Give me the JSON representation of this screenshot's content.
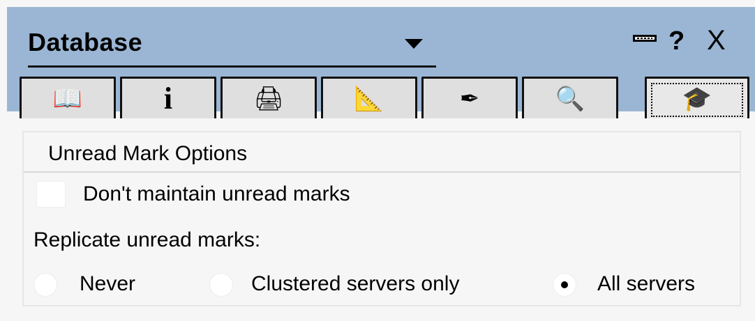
{
  "panel": {
    "title": "Database",
    "controls": {
      "minimize_icon": "minimize-icon",
      "help_label": "?",
      "close_label": "X"
    }
  },
  "tabs": [
    {
      "icon": "book-icon",
      "glyph": "📖",
      "active": false
    },
    {
      "icon": "info-icon",
      "glyph": "i",
      "active": false
    },
    {
      "icon": "printer-icon",
      "glyph": "🖨",
      "active": false
    },
    {
      "icon": "ruler-triangle-icon",
      "glyph": "📐",
      "active": false
    },
    {
      "icon": "pen-icon",
      "glyph": "✒",
      "active": false
    },
    {
      "icon": "magnifier-icon",
      "glyph": "🔍",
      "active": false
    },
    {
      "icon": "cap-icon",
      "glyph": "🎓",
      "active": true
    }
  ],
  "section": {
    "title": "Unread Mark Options",
    "checkbox": {
      "label": "Don't maintain unread marks",
      "checked": false
    },
    "radio_group": {
      "label": "Replicate unread marks:",
      "options": [
        {
          "label": "Never",
          "checked": false
        },
        {
          "label": "Clustered servers only",
          "checked": false
        },
        {
          "label": "All servers",
          "checked": true
        }
      ]
    }
  }
}
